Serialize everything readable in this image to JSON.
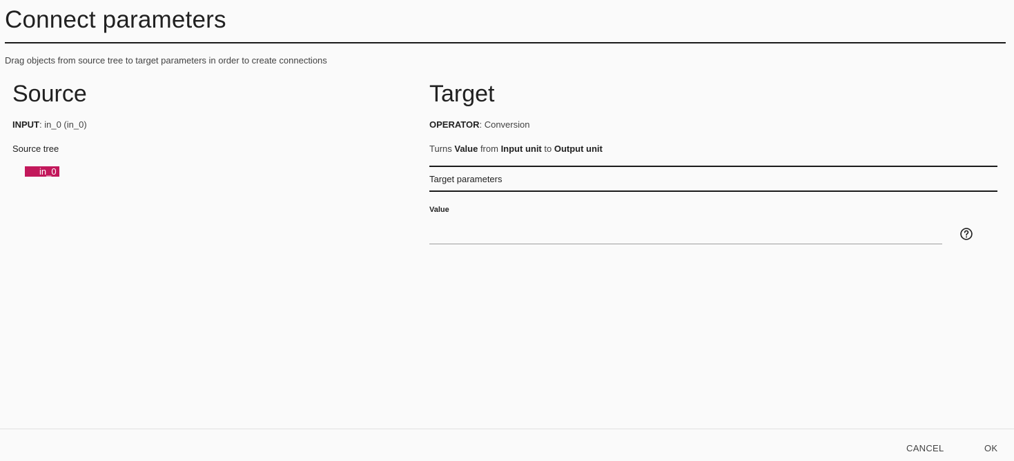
{
  "dialog": {
    "title": "Connect parameters",
    "instructions": "Drag objects from source tree to target parameters in order to create connections"
  },
  "source": {
    "title": "Source",
    "input_key": "INPUT",
    "input_value": ": in_0 (in_0)",
    "tree_label": "Source tree",
    "tree_nodes": [
      {
        "label": "in_0",
        "color": "#c2185b"
      }
    ]
  },
  "target": {
    "title": "Target",
    "operator_key": "OPERATOR",
    "operator_value": ": Conversion",
    "description": {
      "part1": "Turns ",
      "value": "Value",
      "part2": " from ",
      "input_unit": "Input unit",
      "part3": " to ",
      "output_unit": "Output unit"
    },
    "params_label": "Target parameters",
    "fields": [
      {
        "label": "Value",
        "value": "",
        "help_icon": "help-circle-icon"
      }
    ]
  },
  "footer": {
    "cancel_label": "CANCEL",
    "ok_label": "OK"
  },
  "colors": {
    "accent": "#c2185b",
    "background": "#fafafa"
  }
}
